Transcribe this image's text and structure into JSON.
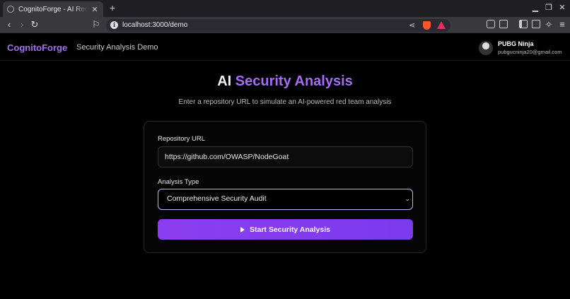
{
  "browser": {
    "tab_title": "CognitoForge - AI Red Team",
    "new_tab_symbol": "+",
    "close_symbol": "✕",
    "url": "localhost:3000/demo"
  },
  "header": {
    "brand": "CognitoForge",
    "nav_link": "Security Analysis Demo",
    "user_name": "PUBG Ninja",
    "user_email": "pubgucninja20@gmail.com"
  },
  "hero": {
    "title_prefix": "AI",
    "title_highlight": "Security Analysis",
    "subtitle": "Enter a repository URL to simulate an AI-powered red team analysis"
  },
  "form": {
    "repo_label": "Repository URL",
    "repo_value": "https://github.com/OWASP/NodeGoat",
    "analysis_label": "Analysis Type",
    "analysis_selected": "Comprehensive Security Audit",
    "submit_label": "Start Security Analysis"
  },
  "colors": {
    "accent": "#a66cf2",
    "button": "#8b3ef0",
    "select_border": "#c2aef7"
  },
  "icons": [
    "globe-icon",
    "back-icon",
    "forward-icon",
    "reload-icon",
    "bookmark-icon",
    "info-icon",
    "share-icon",
    "brave-shield-icon",
    "brave-rewards-icon",
    "extensions-icon",
    "play-icon",
    "chevron-down-icon"
  ]
}
